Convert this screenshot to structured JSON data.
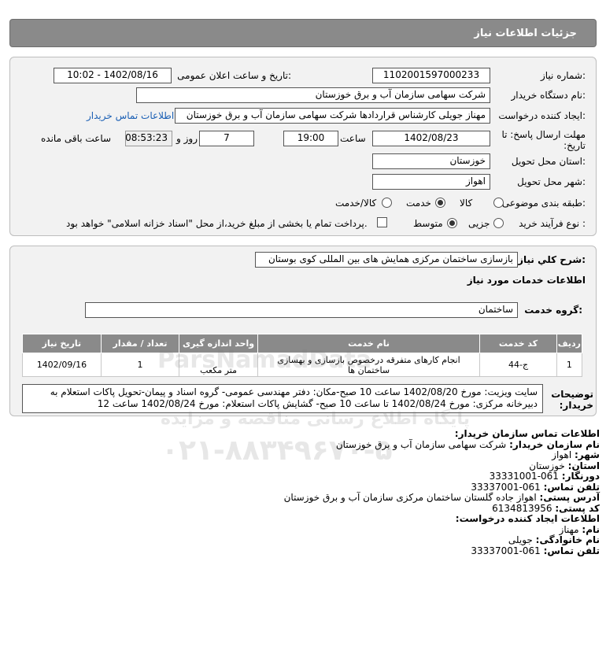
{
  "header": {
    "title": "جزئیات اطلاعات نیاز"
  },
  "form": {
    "need_number_label": "شماره نیاز:",
    "need_number": "1102001597000233",
    "announce_label": "تاریخ و ساعت اعلان عمومی:",
    "announce_value": "1402/08/16 - 10:02",
    "buyer_org_label": "نام دستگاه خریدار:",
    "buyer_org": "شرکت سهامی سازمان آب و برق خوزستان",
    "creator_label": "ایجاد کننده درخواست:",
    "creator": "مهناز جویلی کارشناس قراردادها شرکت سهامی سازمان آب و برق خوزستان",
    "contact_link": "اطلاعات تماس خریدار",
    "deadline_label": "مهلت ارسال پاسخ: تا تاریخ:",
    "deadline_date": "1402/08/23",
    "time_label": "ساعت",
    "deadline_time": "19:00",
    "days_value": "7",
    "days_label": "روز و",
    "remaining_value": "08:53:23",
    "remaining_label": "ساعت باقی مانده",
    "province_label": "استان محل تحویل:",
    "province": "خوزستان",
    "city_label": "شهر محل تحویل:",
    "city": "اهواز",
    "category_label": "طبقه بندی موضوعی:",
    "category_options": [
      "کالا",
      "خدمت",
      "کالا/خدمت"
    ],
    "category_selected": "خدمت",
    "process_label": "نوع فرآیند خرید :",
    "process_options": [
      "جزیی",
      "متوسط"
    ],
    "process_selected": "متوسط",
    "payment_note": "پرداخت تمام یا بخشی از مبلغ خرید،از محل \"اسناد خزانه اسلامی\" خواهد بود."
  },
  "summary": {
    "title_label": "شرح کلي نياز:",
    "title_value": "بازسازی ساختمان مرکزی همایش های بین المللی کوی بوستان",
    "services_heading": "اطلاعات خدمات مورد نیاز",
    "service_group_label": "گروه خدمت:",
    "service_group": "ساختمان",
    "table": {
      "headers": [
        "ردیف",
        "کد خدمت",
        "نام خدمت",
        "واحد اندازه گیری",
        "تعداد / مقدار",
        "تاریخ نیاز"
      ],
      "rows": [
        [
          "1",
          "ج-44",
          "انجام کارهای متفرقه درخصوص بازسازی و بهسازی ساختمان ها",
          "متر مکعب",
          "1",
          "1402/09/16"
        ]
      ]
    },
    "notes_label": "توضیحات خریدار:",
    "notes_value": "سایت ویزیت: مورخ 1402/08/20 ساعت 10 صبح-مکان: دفتر مهندسی عمومی- گروه اسناد و پیمان-تحویل پاکات استعلام به دبیرخانه مرکزی: مورخ 1402/08/24 تا ساعت 10 صبح- گشایش پاکات استعلام: مورخ 1402/08/24 ساعت 12"
  },
  "contact": {
    "heading": "اطلاعات تماس سازمان خریدار:",
    "org_label": "نام سازمان خریدار:",
    "org_value": "شرکت سهامی سازمان آب و برق خوزستان",
    "city_label": "شهر:",
    "city_value": "اهواز",
    "province_label": "استان:",
    "province_value": "خوزستان",
    "fax_label": "دورنگار:",
    "fax_value": "061-33331001",
    "phone_label": "تلفن تماس:",
    "phone_value": "061-33337001",
    "address_label": "آدرس پستی:",
    "address_value": "اهواز جاده گلستان ساختمان مرکزی سازمان آب و برق خوزستان",
    "postal_label": "کد پستی:",
    "postal_value": "6134813956",
    "creator_heading": "اطلاعات ایجاد کننده درخواست:",
    "first_name_label": "نام:",
    "first_name_value": "مهناز",
    "last_name_label": "نام خانوادگی:",
    "last_name_value": "جویلی",
    "creator_phone_label": "تلفن تماس:",
    "creator_phone_value": "061-33337001"
  },
  "watermark": {
    "brand": "ParsNamadData",
    "tagline": "پایگاه اطلاع رسانی مناقصه و مزایده",
    "phone": "۰۲۱-۸۸۳۴۹۶۷۰-۵"
  }
}
